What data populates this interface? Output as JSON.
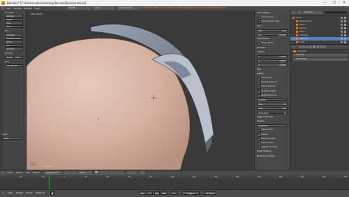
{
  "window": {
    "title": "Blender* [C:\\Users\\nulku\\Desktop\\Rossan\\Rossian.blend]",
    "controls": [
      "—",
      "☐",
      "✕"
    ]
  },
  "info_header": {
    "menus": [
      "File",
      "Render",
      "Window",
      "Help"
    ],
    "layout": "Default",
    "scene": "Scene",
    "engine": "Blender Render",
    "stats": "v2.79 | Verts:6,952 | Faces:6,883 | Tris:13,758 | Objects:1/3 | Lamps:0/1 | Mem:25.46M | Cube"
  },
  "tool_shelf": {
    "sections": [
      {
        "header": "Transform",
        "items": [
          "Translate",
          "Rotate",
          "Scale",
          "Mirror"
        ]
      },
      {
        "header": "Edit",
        "items": [
          "Duplicate",
          "Duplicate Linked",
          "Delete",
          "Join",
          "Set Origin"
        ]
      },
      {
        "header": "Shading",
        "items": [
          "Smooth",
          "Flat"
        ]
      },
      {
        "header": "Data",
        "items": [
          "Data Transfer"
        ]
      }
    ],
    "operator_panel": {
      "header": "Toggle",
      "value": "Toggle"
    }
  },
  "viewport": {
    "label": "User Ortho",
    "object_label": "(1) Cube.002"
  },
  "n_panel": {
    "rows": [
      {
        "type": "sec",
        "label": "Lock to Object:"
      },
      {
        "type": "check",
        "label": "Lock to Cursor"
      },
      {
        "type": "check",
        "label": "Lock Camera to View"
      },
      {
        "type": "sec",
        "label": "Clip:"
      },
      {
        "type": "field",
        "label": "Start:",
        "value": "0.100"
      },
      {
        "type": "field",
        "label": "End:",
        "value": "1000.000"
      },
      {
        "type": "sec",
        "label": "Local Camera:"
      },
      {
        "type": "check",
        "label": "Render Border"
      },
      {
        "type": "sec",
        "label": "3D Cursor"
      },
      {
        "type": "sec",
        "label": "Location:"
      },
      {
        "type": "field",
        "label": "X:",
        "value": "-0.06782"
      },
      {
        "type": "field",
        "label": "Y:",
        "value": "0.08911"
      },
      {
        "type": "field",
        "label": "Z:",
        "value": "0.38414"
      },
      {
        "type": "sec",
        "label": "Item"
      },
      {
        "type": "sec",
        "label": "Display"
      },
      {
        "type": "check",
        "label": "Only Render"
      },
      {
        "type": "check",
        "label": "World Background"
      },
      {
        "type": "check",
        "label": "Outline Selected"
      },
      {
        "type": "check",
        "label": "All Object Origins"
      },
      {
        "type": "check",
        "label": "Relationship Lines"
      },
      {
        "type": "field",
        "label": "Grid Floor",
        "value": ""
      },
      {
        "type": "field",
        "label": "Lines:",
        "value": "16"
      },
      {
        "type": "field",
        "label": "Scale:",
        "value": "1.000"
      },
      {
        "type": "field",
        "label": "Subdivisions:",
        "value": "10"
      },
      {
        "type": "sec",
        "label": "Toggle Quad View"
      },
      {
        "type": "sec",
        "label": "Shading"
      },
      {
        "type": "field",
        "label": "Multitexture",
        "value": ""
      },
      {
        "type": "check",
        "label": "Textured Solid"
      },
      {
        "type": "check",
        "label": "Matcap"
      },
      {
        "type": "check",
        "label": "Backface Culling"
      },
      {
        "type": "check",
        "label": "Depth of Field"
      },
      {
        "type": "check",
        "label": "Ambient Occlusion"
      },
      {
        "type": "sec",
        "label": "Motion Tracking"
      },
      {
        "type": "sec",
        "label": "Background Images"
      }
    ]
  },
  "outliner": {
    "view": "All Scenes",
    "search_placeholder": "",
    "items": [
      "Scene",
      "RenderLayers",
      "World",
      "Camera",
      "Cube",
      "Cube.001",
      "Cube.002",
      "Lamp"
    ]
  },
  "properties": {
    "context": "Cube.002",
    "object_name": "Cube.002",
    "add_modifier": "Add Modifier"
  },
  "view3d_header": {
    "menus": [
      "View",
      "Select",
      "Add",
      "Object"
    ],
    "mode": "Object Mode",
    "pivot": "Global",
    "layers_label": ""
  },
  "timeline": {
    "ticks": [
      "-40",
      "-20",
      "0",
      "20",
      "40",
      "60",
      "80",
      "100",
      "120",
      "140",
      "160",
      "180",
      "200",
      "220",
      "240",
      "260"
    ],
    "current_frame_marker": "0"
  },
  "timeline_header": {
    "menus": [
      "View",
      "Marker",
      "Frame",
      "Playback"
    ],
    "start_label": "Start:",
    "start": "1",
    "end_label": "End:",
    "end": "250",
    "current": "1",
    "sync": "No Sync"
  },
  "colors": {
    "accent_orange": "#e87d0d",
    "selection_blue": "#5680c2",
    "object_label_yellow": "#f2d46b",
    "skin": "#d8b7a8",
    "frame_marker": "#3f9a3f"
  }
}
